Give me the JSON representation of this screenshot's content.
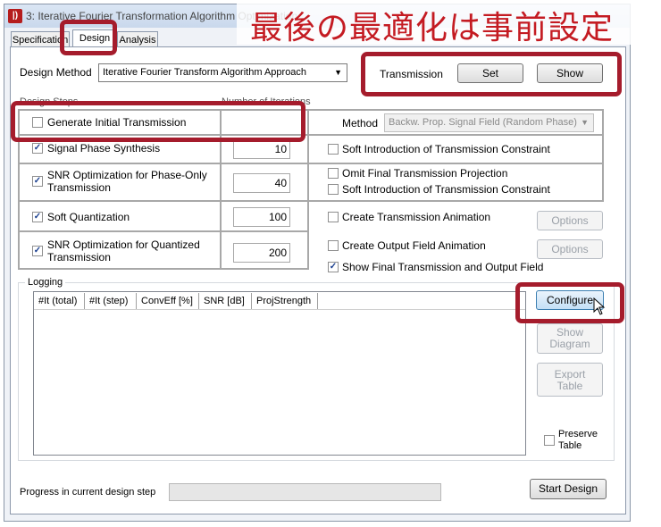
{
  "window": {
    "title": "3: Iterative Fourier Transformation Algorithm Optimization"
  },
  "annotation": {
    "text": "最後の最適化は事前設定"
  },
  "tabs": [
    "Specification",
    "Design",
    "Analysis"
  ],
  "design_method": {
    "label": "Design Method",
    "value": "Iterative Fourier Transform Algorithm Approach"
  },
  "transmission": {
    "label": "Transmission",
    "set": "Set",
    "show": "Show"
  },
  "steps_header": {
    "design_steps": "Design Steps",
    "iterations": "Number of Iterations"
  },
  "steps": [
    {
      "label": "Generate Initial Transmission",
      "checked": false,
      "iterations": ""
    },
    {
      "label": "Signal Phase Synthesis",
      "checked": true,
      "iterations": "10"
    },
    {
      "label": "SNR Optimization for Phase-Only Transmission",
      "checked": true,
      "iterations": "40"
    },
    {
      "label": "Soft Quantization",
      "checked": true,
      "iterations": "100"
    },
    {
      "label": "SNR Optimization for Quantized Transmission",
      "checked": true,
      "iterations": "200"
    }
  ],
  "method": {
    "label": "Method",
    "value": "Backw. Prop. Signal Field (Random Phase)"
  },
  "options": {
    "soft_intro_1": {
      "label": "Soft Introduction of Transmission Constraint",
      "checked": false
    },
    "omit_final": {
      "label": "Omit Final Transmission Projection",
      "checked": false
    },
    "soft_intro_2": {
      "label": "Soft Introduction of Transmission Constraint",
      "checked": false
    },
    "create_trans_anim": {
      "label": "Create Transmission Animation",
      "checked": false
    },
    "create_output_anim": {
      "label": "Create Output Field Animation",
      "checked": false
    },
    "show_final": {
      "label": "Show Final Transmission and Output Field",
      "checked": true
    },
    "options_btn_1": "Options",
    "options_btn_2": "Options"
  },
  "logging": {
    "label": "Logging",
    "columns": [
      "#It (total)",
      "#It (step)",
      "ConvEff [%]",
      "SNR [dB]",
      "ProjStrength"
    ],
    "configure": "Configure",
    "show_diagram_1": "Show",
    "show_diagram_2": "Diagram",
    "export_table_1": "Export",
    "export_table_2": "Table",
    "preserve_1": "Preserve",
    "preserve_2": "Table"
  },
  "progress": {
    "label": "Progress in current design step",
    "value": 0
  },
  "start_design": "Start Design"
}
